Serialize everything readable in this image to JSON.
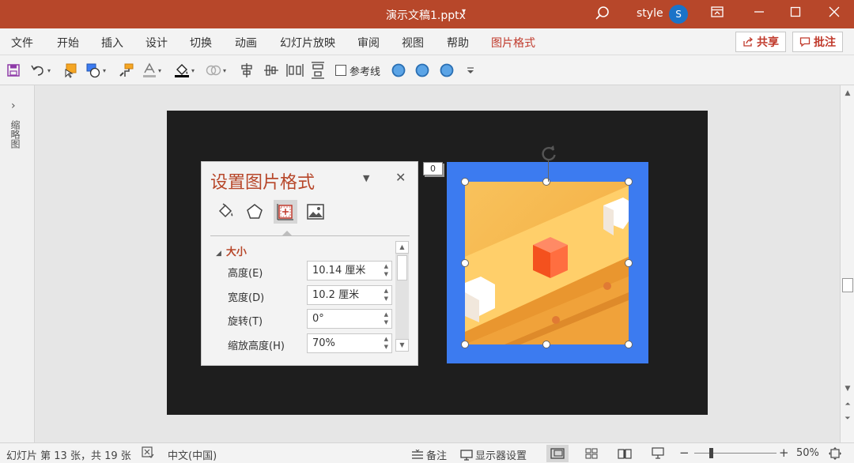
{
  "titlebar": {
    "doc_title": "演示文稿1.pptx",
    "caret": "▾",
    "user_name": "style",
    "avatar_initial": "S"
  },
  "menu": {
    "tabs": [
      "文件",
      "开始",
      "插入",
      "设计",
      "切换",
      "动画",
      "幻灯片放映",
      "审阅",
      "视图",
      "帮助",
      "图片格式"
    ],
    "active_tab": "图片格式",
    "share_label": "共享",
    "comment_label": "批注"
  },
  "toolbar": {
    "guides_label": "参考线"
  },
  "left_panel": {
    "label": "缩略图",
    "expand_glyph": "›"
  },
  "format_pane": {
    "title": "设置图片格式",
    "section": "大小",
    "section_glyph": "◢",
    "fields": [
      {
        "label": "高度(E)",
        "value": "10.14 厘米"
      },
      {
        "label": "宽度(D)",
        "value": "10.2 厘米"
      },
      {
        "label": "旋转(T)",
        "value": "0°"
      },
      {
        "label": "缩放高度(H)",
        "value": "70%"
      }
    ]
  },
  "slide": {
    "badge_text": "0"
  },
  "statusbar": {
    "slide_info": "幻灯片 第 13 张，共 19 张",
    "language": "中文(中国)",
    "notes_label": "备注",
    "display_label": "显示器设置",
    "zoom_minus": "−",
    "zoom_plus": "+",
    "zoom_percent": "50%"
  },
  "colors": {
    "accent": "#b7472a",
    "picture_frame": "#3c7bf0",
    "slide_background": "#1e1e1e"
  }
}
